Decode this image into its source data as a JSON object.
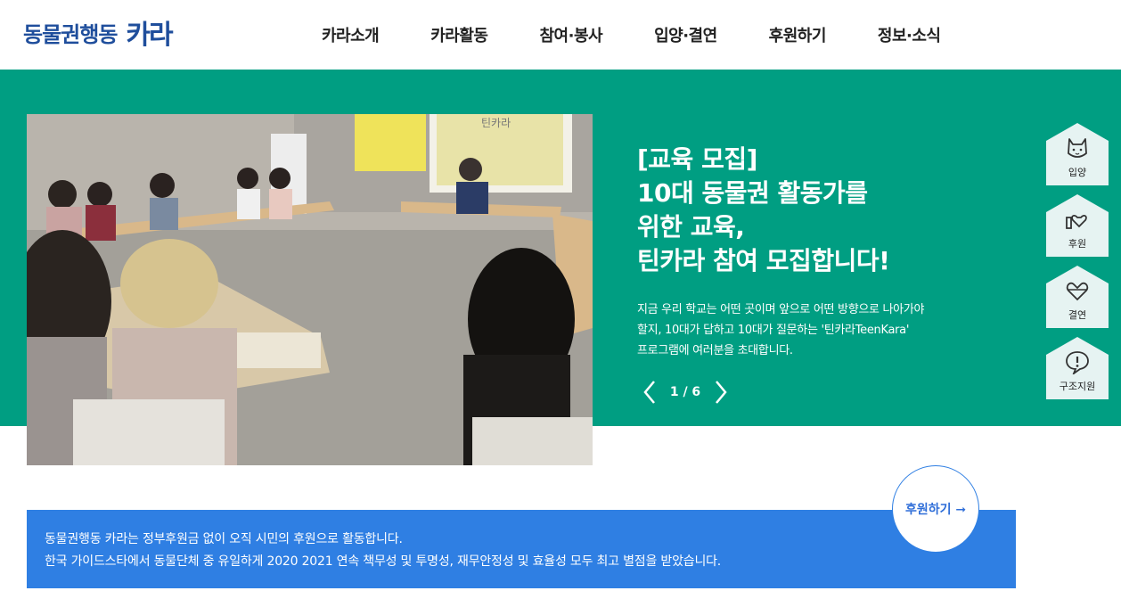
{
  "header": {
    "logo_text": "동물권행동",
    "logo_brand": "카라",
    "nav": [
      "카라소개",
      "카라활동",
      "참여·봉사",
      "입양·결연",
      "후원하기",
      "정보·소식"
    ]
  },
  "slide": {
    "title_lines": [
      "[교육 모집]",
      "10대 동물권 활동가를",
      "위한 교육,",
      "틴카라 참여 모집합니다!"
    ],
    "desc_lines": [
      " 지금 우리 학교는 어떤 곳이며 앞으로 어떤 방향으로 나아가야",
      "할지, 10대가 답하고 10대가 질문하는 '틴카라TeenKara'",
      "프로그램에 여러분을 초대합니다."
    ],
    "counter": "1 / 6",
    "prev_icon": "chevron-left-icon",
    "next_icon": "chevron-right-icon",
    "photo_sign": "틴카라"
  },
  "quick_menu": [
    {
      "label": "입양",
      "icon": "cat-icon"
    },
    {
      "label": "후원",
      "icon": "hand-heart-icon"
    },
    {
      "label": "결연",
      "icon": "heart-link-icon"
    },
    {
      "label": "구조지원",
      "icon": "alert-bubble-icon"
    }
  ],
  "support": {
    "line1": "동물권행동 카라는 정부후원금 없이 오직 시민의 후원으로 활동합니다.",
    "line2": "한국 가이드스타에서 동물단체 중 유일하게 2020 2021 연속 책무성 및 투명성, 재무안정성 및 효율성 모두 최고 별점을 받았습니다.",
    "button_label": "후원하기 ➞"
  },
  "colors": {
    "brand_blue": "#1f4e9c",
    "hero_green": "#009e82",
    "support_blue": "#2f7fe3",
    "quick_bg": "#e6f3f2"
  }
}
